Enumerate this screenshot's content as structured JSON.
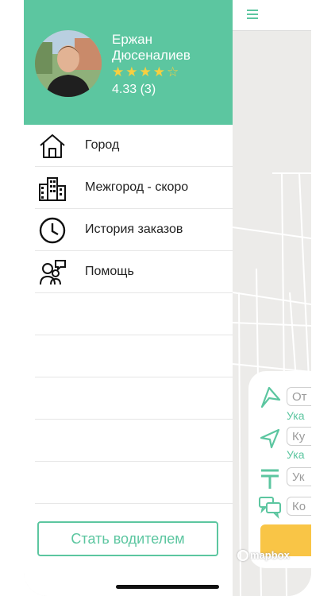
{
  "profile": {
    "first_name": "Ержан",
    "last_name": "Дюсеналиев",
    "stars": "★★★★☆",
    "stars_value": 4,
    "stars_max": 5,
    "rating": "4.33 (3)"
  },
  "menu": {
    "items": [
      {
        "label": "Город",
        "icon": "home-icon"
      },
      {
        "label": "Межгород - скоро",
        "icon": "buildings-icon"
      },
      {
        "label": "История заказов",
        "icon": "clock-icon"
      },
      {
        "label": "Помощь",
        "icon": "people-chat-icon"
      }
    ]
  },
  "drawer": {
    "become_driver_label": "Стать водителем"
  },
  "order_card": {
    "from_placeholder": "От",
    "from_hint": "Ука",
    "to_placeholder": "Ку",
    "to_hint": "Ука",
    "price_placeholder": "Ук",
    "comment_placeholder": "Ко"
  },
  "map": {
    "attribution": "mapbox"
  },
  "colors": {
    "accent": "#5cc6a0",
    "star": "#f8cf3f",
    "button_yellow": "#f9c546"
  }
}
